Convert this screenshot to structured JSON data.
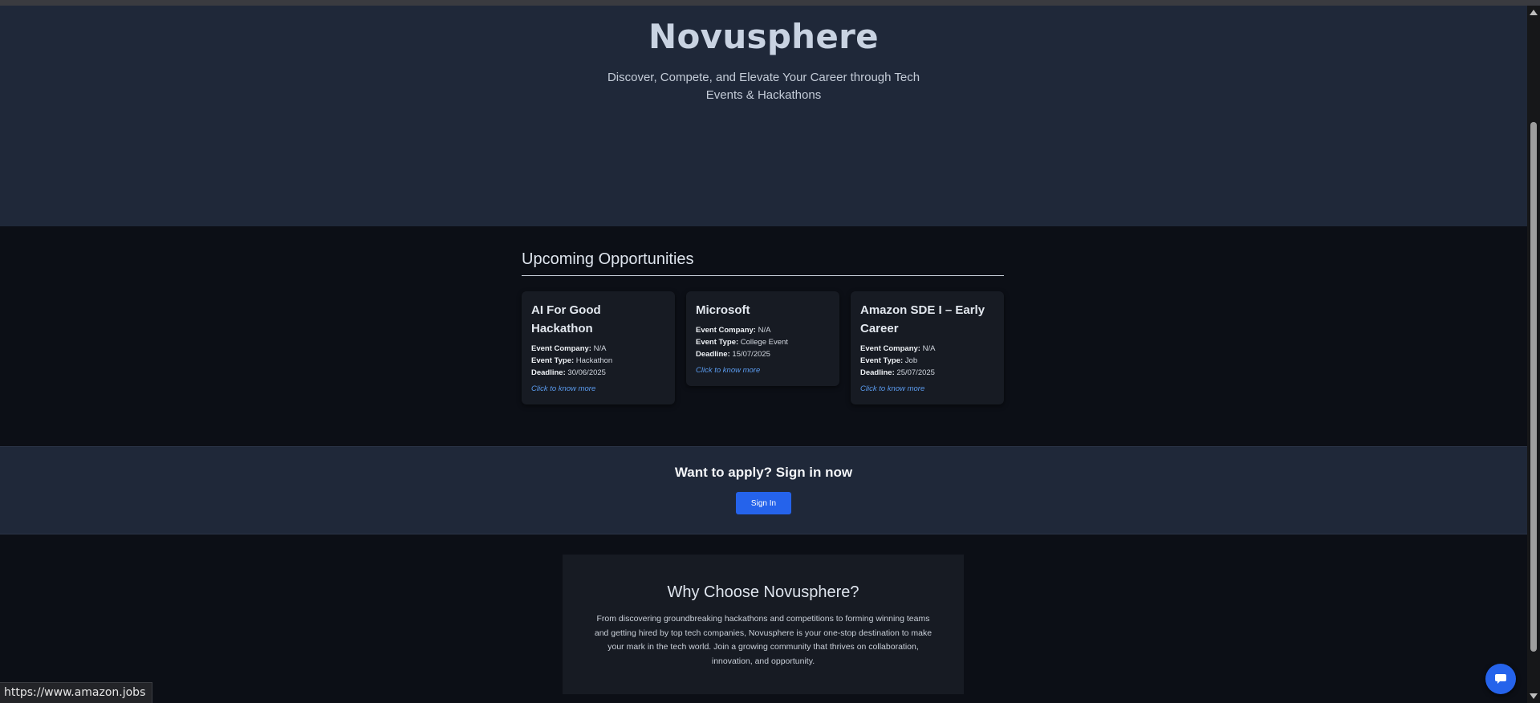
{
  "hero": {
    "title": "Novusphere",
    "tagline": "Discover, Compete, and Elevate Your Career through Tech Events & Hackathons"
  },
  "opportunities": {
    "heading": "Upcoming Opportunities",
    "labels": {
      "company": "Event Company:",
      "type": "Event Type:",
      "deadline": "Deadline:"
    },
    "cards": [
      {
        "title": "AI For Good Hackathon",
        "company": "N/A",
        "type": "Hackathon",
        "deadline": "30/06/2025",
        "link": "Click to know more"
      },
      {
        "title": "Microsoft",
        "company": "N/A",
        "type": "College Event",
        "deadline": "15/07/2025",
        "link": "Click to know more"
      },
      {
        "title": "Amazon SDE I – Early Career",
        "company": "N/A",
        "type": "Job",
        "deadline": "25/07/2025",
        "link": "Click to know more"
      }
    ]
  },
  "signin": {
    "heading": "Want to apply? Sign in now",
    "button": "Sign In"
  },
  "why": {
    "heading": "Why Choose Novusphere?",
    "body": "From discovering groundbreaking hackathons and competitions to forming winning teams and getting hired by top tech companies, Novusphere is your one-stop destination to make your mark in the tech world. Join a growing community that thrives on collaboration, innovation, and opportunity."
  },
  "status_bar": {
    "url": "https://www.amazon.jobs"
  },
  "icons": {
    "chat": "chat-bubble-icon",
    "scroll_up": "scroll-up-arrow-icon",
    "scroll_down": "scroll-down-arrow-icon"
  },
  "colors": {
    "accent": "#2563eb",
    "link": "#5b9cf0",
    "hero_bg": "#1f2839",
    "page_bg": "#0c0f16",
    "card_bg": "#171b23"
  }
}
